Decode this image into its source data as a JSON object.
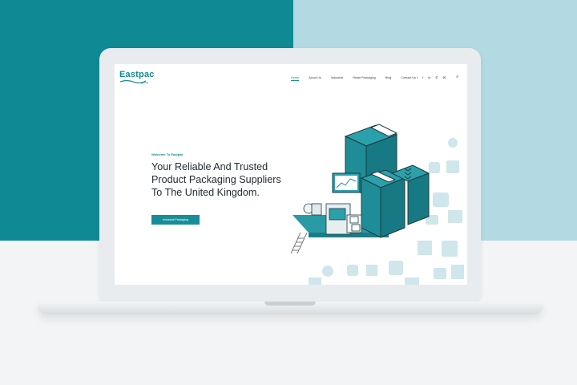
{
  "colors": {
    "teal": "#0f8a95",
    "light_teal": "#b3d9e2",
    "accent": "#178d99",
    "text": "#1f2a30"
  },
  "site": {
    "logo_name": "Eastpac",
    "logo_group": "group",
    "logo_tagline": "—"
  },
  "nav": {
    "items": [
      "Home",
      "About Us",
      "Industrial",
      "Retail Packaging",
      "Blog",
      "Contact Us"
    ]
  },
  "socials": {
    "icons": [
      "twitter-icon",
      "facebook-icon",
      "linkedin-icon",
      "phone-icon",
      "mail-icon"
    ],
    "glyphs": [
      "t",
      "f",
      "in",
      "✆",
      "✉"
    ]
  },
  "search": {
    "icon": "search-icon",
    "glyph": "⌕"
  },
  "hero": {
    "welcome": "Welcome To Eastpac",
    "headline_line1": "Your Reliable And Trusted",
    "headline_line2": "Product Packaging Suppliers",
    "headline_line3": "To The United Kingdom.",
    "cta_label": "Industrial Packaging"
  }
}
